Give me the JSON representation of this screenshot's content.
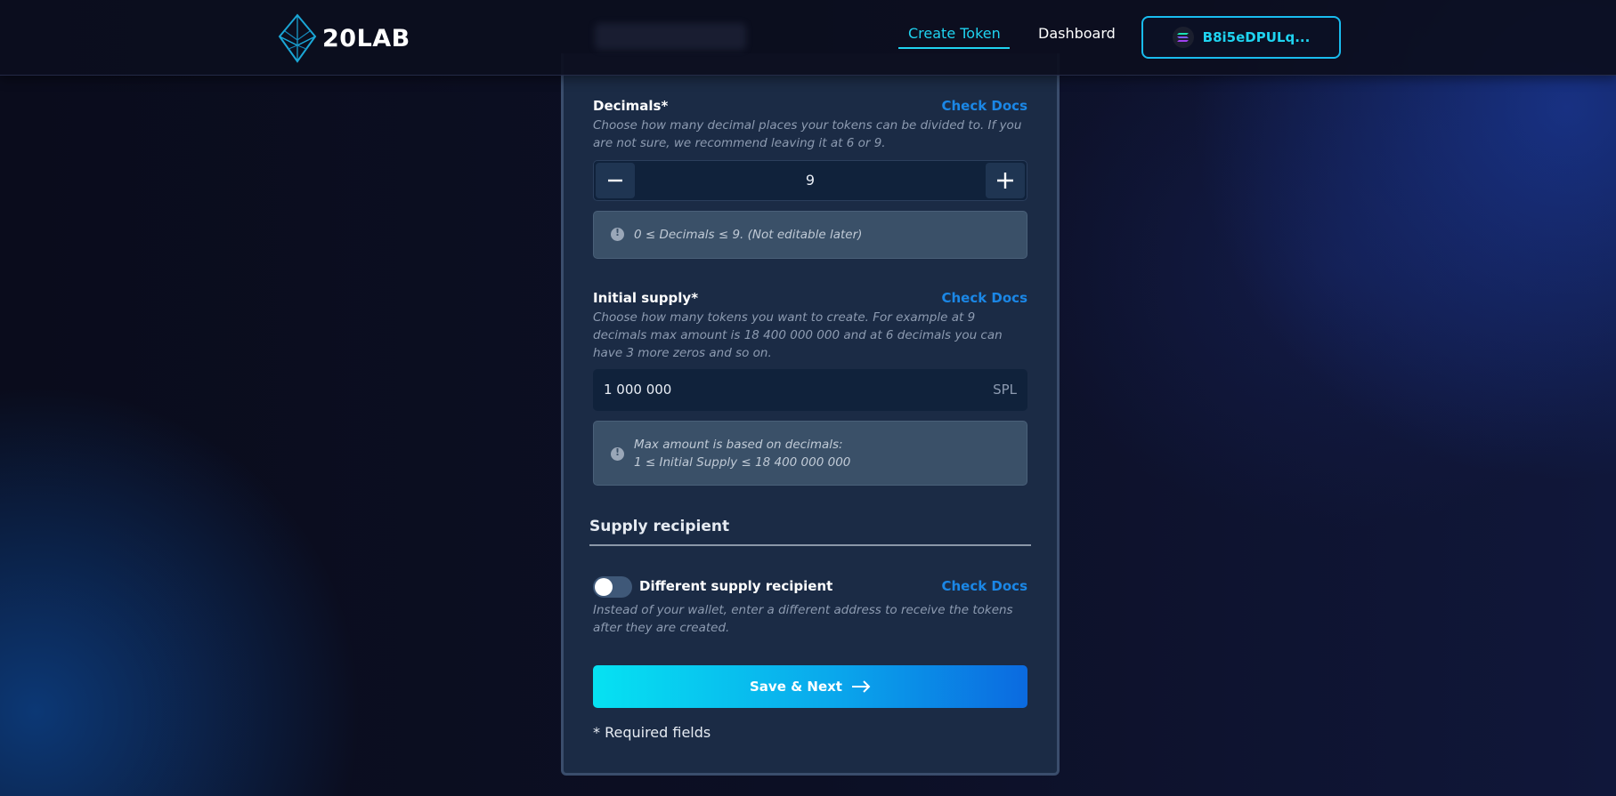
{
  "header": {
    "logo_text": "20LAB",
    "nav": {
      "create_token": "Create Token",
      "dashboard": "Dashboard"
    },
    "wallet": {
      "label": "B8i5eDPULq...",
      "icon": "solana-icon"
    }
  },
  "form": {
    "decimals": {
      "label": "Decimals*",
      "docs": "Check Docs",
      "description": "Choose how many decimal places your tokens can be divided to. If you are not sure, we recommend leaving it at 6 or 9.",
      "value": "9",
      "info": "0 ≤ Decimals ≤ 9. (Not editable later)"
    },
    "initial_supply": {
      "label": "Initial supply*",
      "docs": "Check Docs",
      "description": "Choose how many tokens you want to create. For example at 9 decimals max amount is 18 400 000 000 and at 6 decimals you can have 3 more zeros and so on.",
      "value": "1 000 000",
      "suffix": "SPL",
      "info_line1": "Max amount is based on decimals:",
      "info_line2": "1 ≤ Initial Supply ≤ 18 400 000 000"
    },
    "supply_recipient": {
      "section_title": "Supply recipient",
      "toggle_label": "Different supply recipient",
      "toggle_on": false,
      "docs": "Check Docs",
      "description": "Instead of your wallet, enter a different address to receive the tokens after they are created."
    },
    "save_button": "Save & Next",
    "required_note": "* Required fields"
  },
  "colors": {
    "accent": "#1fd3f0",
    "link": "#1b87e6",
    "card": "#1b2b45"
  }
}
